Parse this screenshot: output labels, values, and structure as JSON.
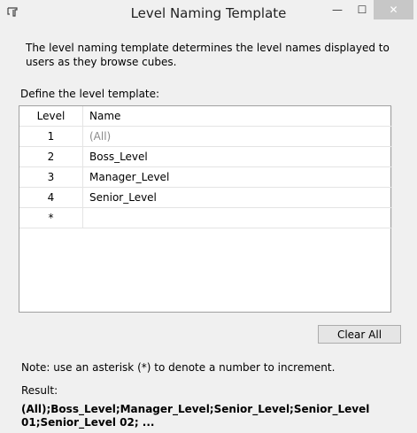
{
  "window": {
    "title": "Level Naming Template",
    "minimize_glyph": "—",
    "maximize_glyph": "☐",
    "close_glyph": "✕"
  },
  "intro_text": "The level naming template determines the level names displayed to users as they browse cubes.",
  "define_label": "Define the level template:",
  "grid": {
    "columns": [
      "Level",
      "Name"
    ],
    "rows": [
      {
        "level": "1",
        "name": "(All)",
        "placeholder": true
      },
      {
        "level": "2",
        "name": "Boss_Level",
        "placeholder": false
      },
      {
        "level": "3",
        "name": "Manager_Level",
        "placeholder": false
      },
      {
        "level": "4",
        "name": "Senior_Level",
        "placeholder": false
      },
      {
        "level": "*",
        "name": "",
        "placeholder": false
      }
    ]
  },
  "clear_all_label": "Clear All",
  "note_text": "Note: use an asterisk (*) to denote a number to increment.",
  "result_label": "Result:",
  "result_value": "(All);Boss_Level;Manager_Level;Senior_Level;Senior_Level 01;Senior_Level 02; ..."
}
